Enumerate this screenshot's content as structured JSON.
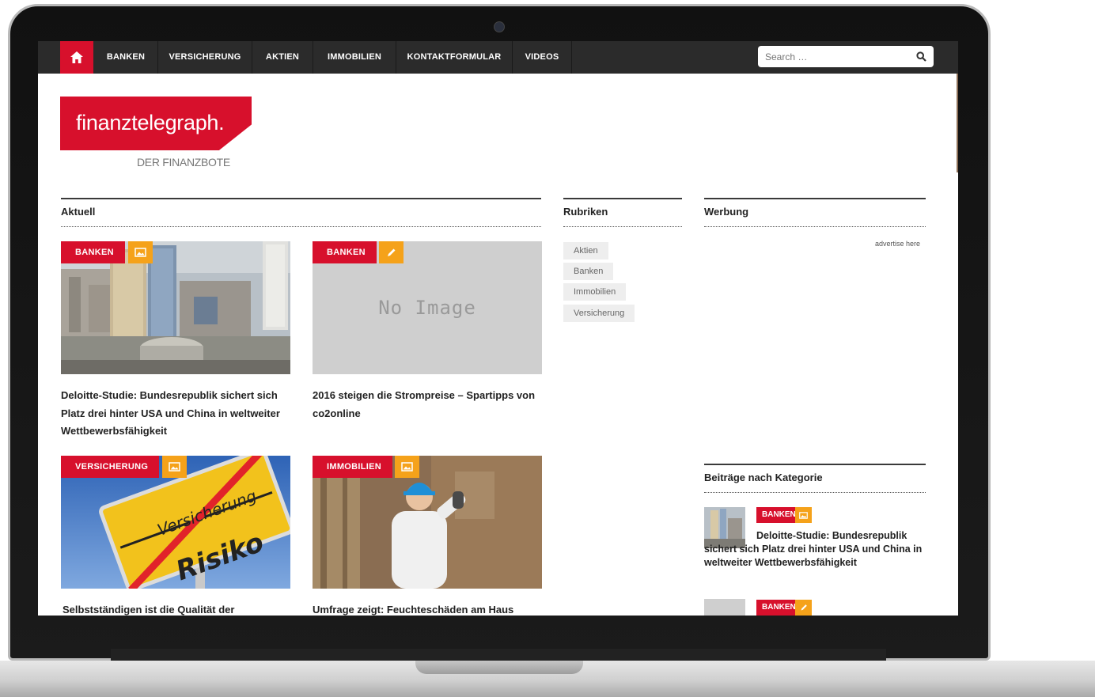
{
  "nav": {
    "items": [
      {
        "label": "BANKEN"
      },
      {
        "label": "VERSICHERUNG"
      },
      {
        "label": "AKTIEN"
      },
      {
        "label": "IMMOBILIEN"
      },
      {
        "label": "KONTAKTFORMULAR"
      },
      {
        "label": "VIDEOS"
      }
    ],
    "search_placeholder": "Search …"
  },
  "logo": {
    "name": "finanztelegraph.",
    "tagline": "DER FINANZBOTE"
  },
  "sections": {
    "aktuell": "Aktuell",
    "rubriken": "Rubriken",
    "werbung": "Werbung",
    "beitraege": "Beiträge nach Kategorie"
  },
  "articles": [
    {
      "tag": "BANKEN",
      "title": "Deloitte-Studie: Bundesrepublik sichert sich Platz drei hinter USA und China in weltweiter Wettbewerbsfähigkeit",
      "icon": "image-icon"
    },
    {
      "tag": "BANKEN",
      "title": "2016 steigen die Strompreise – Spartipps von co2online",
      "icon": "pencil-icon",
      "no_image_text": "No Image"
    },
    {
      "tag": "VERSICHERUNG",
      "title": "Selbstständigen ist die Qualität der",
      "icon": "image-icon",
      "sign_top": "Versicherung",
      "sign_bottom": "Risiko"
    },
    {
      "tag": "IMMOBILIEN",
      "title": "Umfrage zeigt: Feuchteschäden am Haus",
      "icon": "image-icon"
    }
  ],
  "rubriken": [
    "Aktien",
    "Banken",
    "Immobilien",
    "Versicherung"
  ],
  "werbung": {
    "ad_text": "advertise here"
  },
  "sidebar_posts": [
    {
      "tag": "BANKEN",
      "title": "Deloitte-Studie: Bundesrepublik sichert sich Platz drei hinter USA und China in weltweiter Wettbewerbsfähigkeit",
      "icon": "image-icon"
    },
    {
      "tag": "BANKEN",
      "icon": "pencil-icon"
    }
  ],
  "colors": {
    "accent": "#d7102c",
    "tag_icon": "#f5a21a",
    "nav_bg": "#2b2b2b"
  }
}
